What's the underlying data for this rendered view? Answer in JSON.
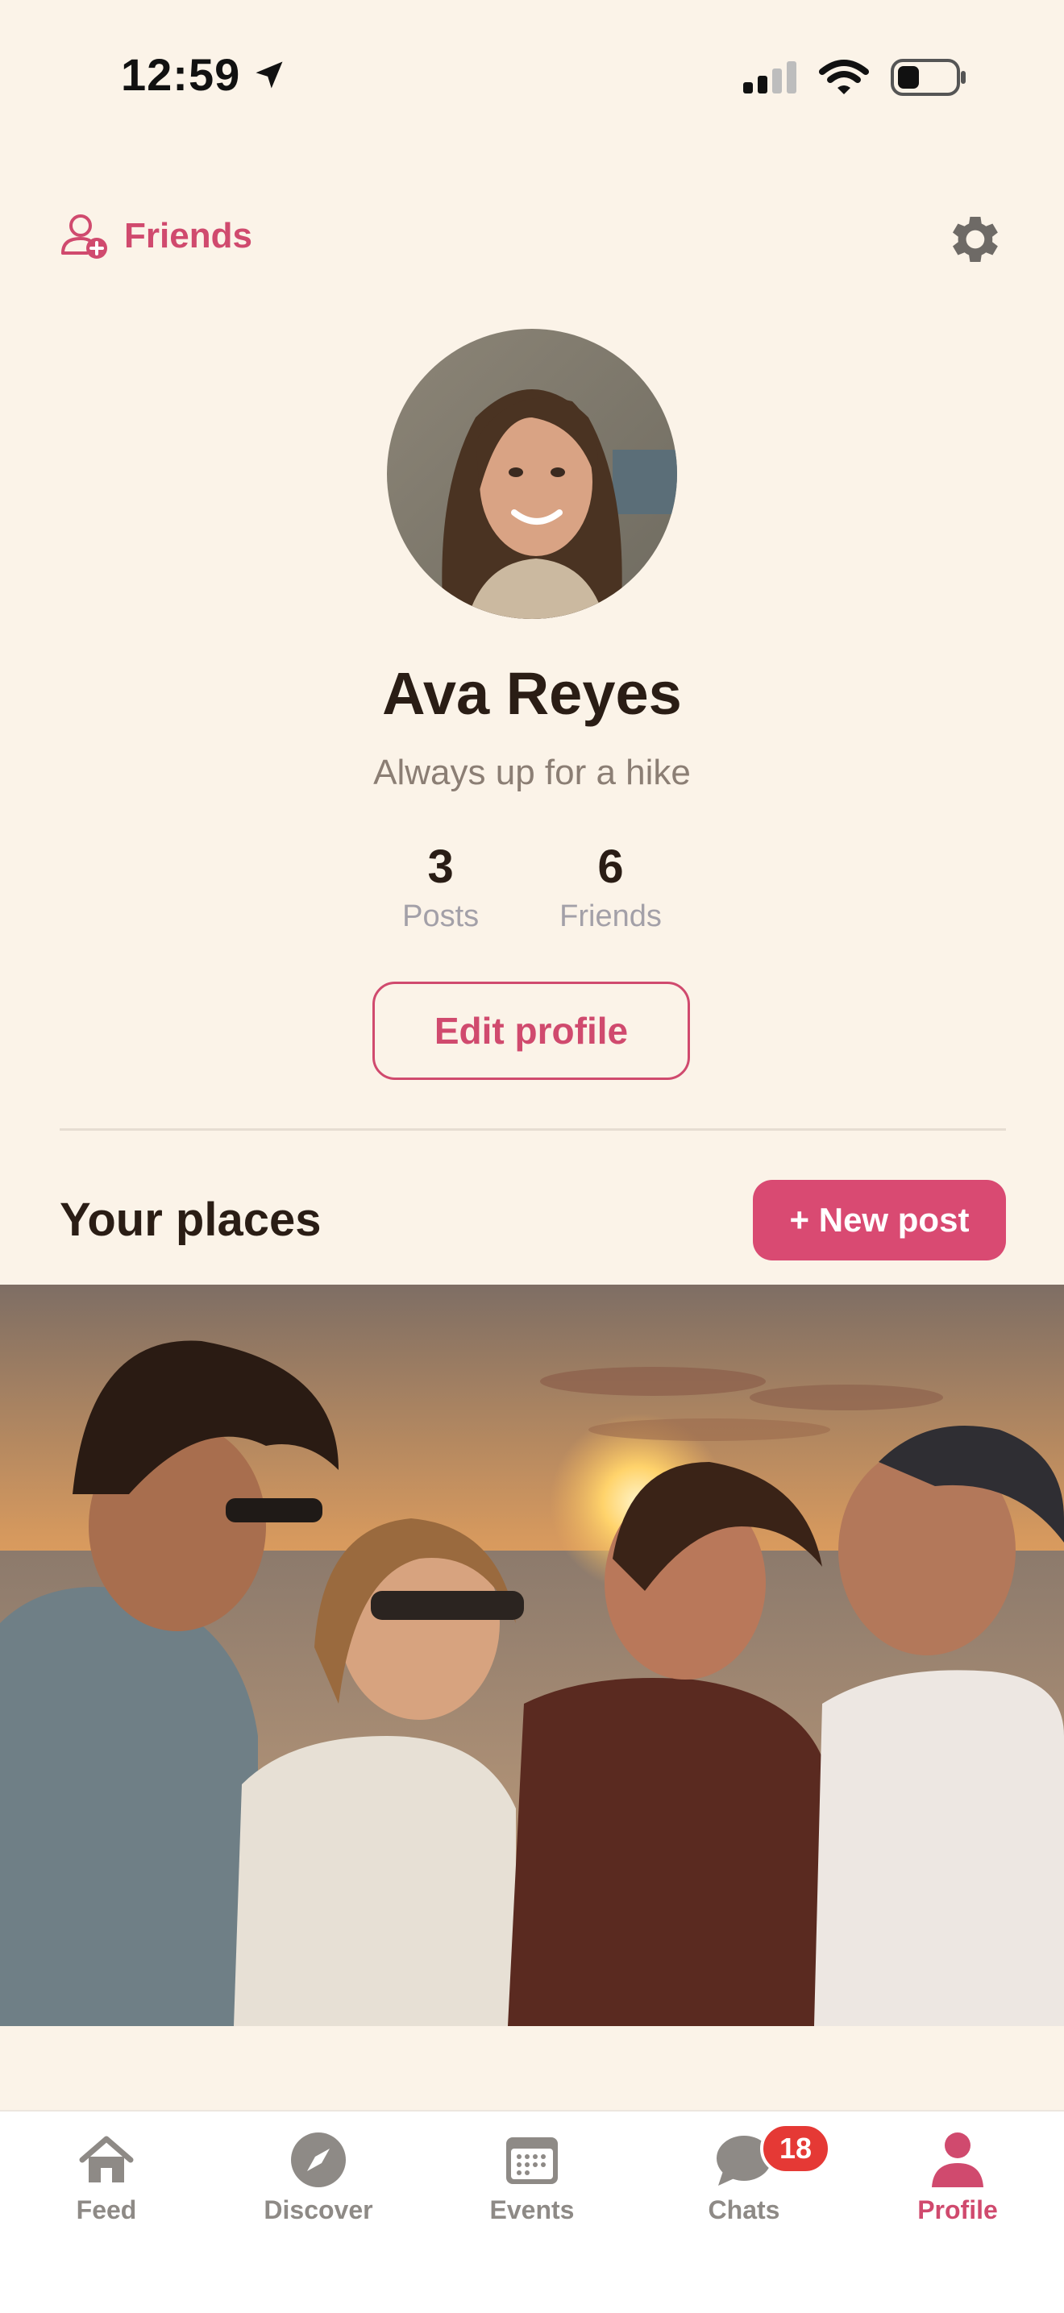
{
  "status_bar": {
    "time": "12:59"
  },
  "header": {
    "friends_label": "Friends"
  },
  "profile": {
    "name": "Ava Reyes",
    "bio": "Always up for a hike",
    "stats": [
      {
        "value": "3",
        "label": "Posts"
      },
      {
        "value": "6",
        "label": "Friends"
      }
    ],
    "edit_label": "Edit profile"
  },
  "places": {
    "title": "Your places",
    "new_post_label": "+ New post"
  },
  "tabs": [
    {
      "label": "Feed",
      "icon": "home-icon"
    },
    {
      "label": "Discover",
      "icon": "compass-icon"
    },
    {
      "label": "Events",
      "icon": "calendar-icon"
    },
    {
      "label": "Chats",
      "icon": "chat-icon",
      "badge": "18"
    },
    {
      "label": "Profile",
      "icon": "person-icon",
      "active": true
    }
  ],
  "colors": {
    "accent": "#D04A6E",
    "background": "#FBF3E8",
    "badge": "#E53935"
  }
}
